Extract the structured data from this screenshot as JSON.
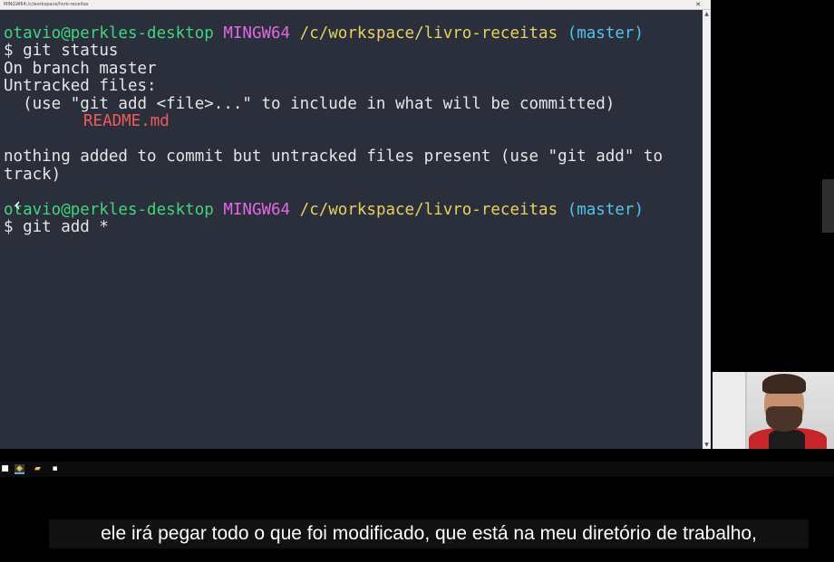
{
  "window": {
    "title": "MINGW64:/c/workspace/livro-receitas",
    "close_glyph": "✕"
  },
  "terminal": {
    "prompt1": {
      "user_host": "otavio@perkles-desktop",
      "shell": "MINGW64",
      "path": "/c/workspace/livro-receitas",
      "branch": "(master)"
    },
    "cmd1": "$ git status",
    "out1": "On branch master",
    "out2": "Untracked files:",
    "out3": "  (use \"git add <file>...\" to include in what will be committed)",
    "untracked_file": "README.md",
    "out4": "nothing added to commit but untracked files present (use \"git add\" to",
    "out5": "track)",
    "prompt2": {
      "user_host": "otavio@perkles-desktop",
      "shell": "MINGW64",
      "path": "/c/workspace/livro-receitas",
      "branch": "(master)"
    },
    "cmd2": "$ git add *"
  },
  "video": {
    "prev_glyph": "‹"
  },
  "taskbar": {
    "start_glyph": "■",
    "app1_glyph": "◆",
    "app2_glyph": "▰",
    "app3_glyph": "▪"
  },
  "caption": {
    "text": "ele irá pegar todo o que foi modificado, que está na meu diretório de trabalho,"
  },
  "colors": {
    "terminal_bg": "#2b2e3b",
    "user_host": "#3fd67e",
    "shell": "#e468e6",
    "path": "#e6d35f",
    "branch": "#4cc7e8",
    "untracked": "#ee5c5c"
  }
}
